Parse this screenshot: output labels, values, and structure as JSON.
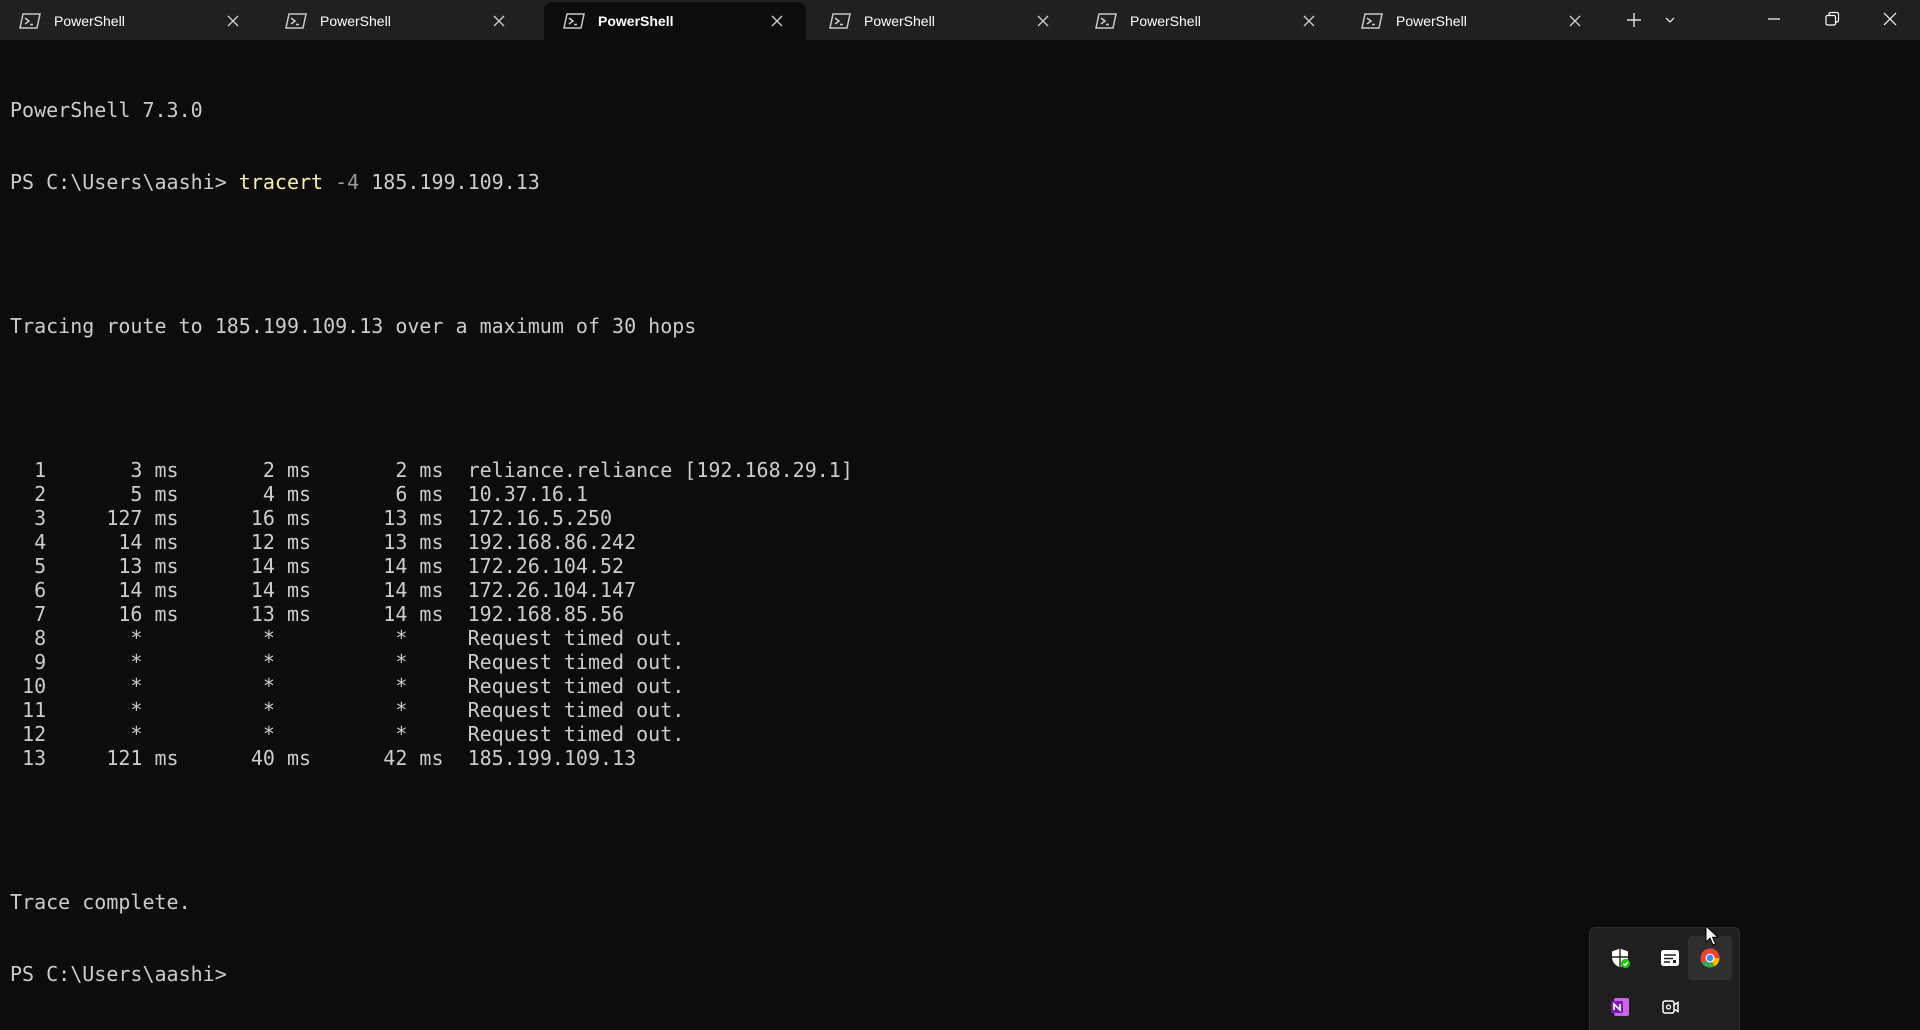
{
  "tabs": [
    {
      "label": "PowerShell",
      "active": false
    },
    {
      "label": "PowerShell",
      "active": false
    },
    {
      "label": "PowerShell",
      "active": true
    },
    {
      "label": "PowerShell",
      "active": false
    },
    {
      "label": "PowerShell",
      "active": false
    },
    {
      "label": "PowerShell",
      "active": false
    }
  ],
  "icons": {
    "tab": "powershell-icon",
    "tab_close": "close-icon",
    "new_tab": "plus-icon",
    "dropdown": "chevron-down-icon",
    "minimize": "minimize-icon",
    "restore": "restore-icon",
    "close_window": "close-icon"
  },
  "terminal": {
    "version_line": "PowerShell 7.3.0",
    "prompt": "PS C:\\Users\\aashi> ",
    "command": {
      "name": "tracert",
      "flag": "-4",
      "arg": "185.199.109.13"
    },
    "trace_header": "Tracing route to 185.199.109.13 over a maximum of 30 hops",
    "hops": [
      {
        "hop": "1",
        "rtt1": "3 ms",
        "rtt2": "2 ms",
        "rtt3": "2 ms",
        "host": "reliance.reliance [192.168.29.1]"
      },
      {
        "hop": "2",
        "rtt1": "5 ms",
        "rtt2": "4 ms",
        "rtt3": "6 ms",
        "host": "10.37.16.1"
      },
      {
        "hop": "3",
        "rtt1": "127 ms",
        "rtt2": "16 ms",
        "rtt3": "13 ms",
        "host": "172.16.5.250"
      },
      {
        "hop": "4",
        "rtt1": "14 ms",
        "rtt2": "12 ms",
        "rtt3": "13 ms",
        "host": "192.168.86.242"
      },
      {
        "hop": "5",
        "rtt1": "13 ms",
        "rtt2": "14 ms",
        "rtt3": "14 ms",
        "host": "172.26.104.52"
      },
      {
        "hop": "6",
        "rtt1": "14 ms",
        "rtt2": "14 ms",
        "rtt3": "14 ms",
        "host": "172.26.104.147"
      },
      {
        "hop": "7",
        "rtt1": "16 ms",
        "rtt2": "13 ms",
        "rtt3": "14 ms",
        "host": "192.168.85.56"
      },
      {
        "hop": "8",
        "rtt1": "*",
        "rtt2": "*",
        "rtt3": "*",
        "host": "Request timed out."
      },
      {
        "hop": "9",
        "rtt1": "*",
        "rtt2": "*",
        "rtt3": "*",
        "host": "Request timed out."
      },
      {
        "hop": "10",
        "rtt1": "*",
        "rtt2": "*",
        "rtt3": "*",
        "host": "Request timed out."
      },
      {
        "hop": "11",
        "rtt1": "*",
        "rtt2": "*",
        "rtt3": "*",
        "host": "Request timed out."
      },
      {
        "hop": "12",
        "rtt1": "*",
        "rtt2": "*",
        "rtt3": "*",
        "host": "Request timed out."
      },
      {
        "hop": "13",
        "rtt1": "121 ms",
        "rtt2": "40 ms",
        "rtt3": "42 ms",
        "host": "185.199.109.13"
      }
    ],
    "complete": "Trace complete."
  },
  "tray": {
    "icons": [
      "windows-security-icon",
      "news-widget-icon",
      "chrome-icon",
      "onenote-icon",
      "camera-icon"
    ],
    "hovered": "chrome-icon"
  },
  "colors": {
    "terminal_bg": "#0c0c0c",
    "terminal_fg": "#cccccc",
    "command_name": "#f9f1a5",
    "command_flag": "#9a9a9a",
    "titlebar_bg": "#202020",
    "security_green": "#16c60c",
    "onenote_purple": "#7719aa"
  }
}
